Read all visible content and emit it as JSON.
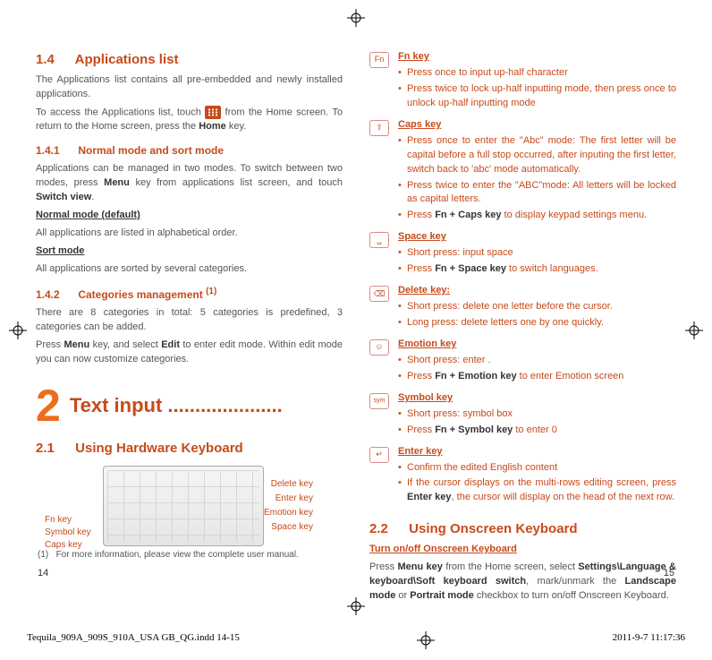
{
  "left": {
    "sec14_num": "1.4",
    "sec14_title": "Applications list",
    "sec14_p1": "The Applications list contains all pre-embedded and newly installed applications.",
    "sec14_p2a": "To access the Applications list, touch ",
    "sec14_p2b": " from the Home screen. To return to the Home screen, press the ",
    "sec14_p2c": " key.",
    "home": "Home",
    "sec141_num": "1.4.1",
    "sec141_title": "Normal mode and sort mode",
    "sec141_p1a": "Applications can be managed in two modes. To switch between two modes, press ",
    "menu": "Menu",
    "sec141_p1b": " key from applications list screen, and touch ",
    "switchview": "Switch view",
    "sec141_p1c": ".",
    "normal_mode": "Normal mode (default)",
    "normal_desc": "All applications are listed in alphabetical order.",
    "sort_mode": "Sort mode",
    "sort_desc": "All applications are sorted by several categories.",
    "sec142_num": "1.4.2",
    "sec142_title": "Categories management ",
    "sec142_sup": "(1)",
    "sec142_p1": "There are 8 categories in total: 5 categories is predefined, 3 categories can be added.",
    "sec142_p2a": "Press ",
    "sec142_p2b": " key, and select ",
    "edit": "Edit",
    "sec142_p2c": " to enter edit mode. Within edit mode you can now customize categories.",
    "chap2_num": "2",
    "chap2_title": "Text input .....................",
    "sec21_num": "2.1",
    "sec21_title": "Using Hardware Keyboard",
    "kbd_labels": {
      "delete": "Delete key",
      "enter": "Enter key",
      "emotion": "Emotion key",
      "space": "Space key",
      "fn": "Fn key",
      "symbol": "Symbol key",
      "caps": "Caps key"
    },
    "footnote_mark": "(1)",
    "footnote": "For more information, please view the complete user manual.",
    "pagenum": "14"
  },
  "right": {
    "fn": {
      "title": "Fn key",
      "items": [
        "Press once to input up-half character",
        "Press twice to lock up-half inputting mode, then press once to unlock up-half inputting mode"
      ]
    },
    "caps": {
      "title": "Caps key",
      "items": [
        "Press once to enter the \"Abc\" mode: The first letter will be capital before a full stop occurred, after inputing the first letter, switch back to 'abc' mode automatically.",
        "Press twice to enter the \"ABC\"mode: All letters will be locked as capital letters."
      ],
      "extra_pre": "Press ",
      "extra_bold": "Fn + Caps key",
      "extra_post": " to display keypad settings menu."
    },
    "space": {
      "title": "Space key",
      "i1": "Short press: input space",
      "i2_pre": "Press ",
      "i2_bold": "Fn + Space key",
      "i2_post": " to switch languages."
    },
    "delete": {
      "title": "Delete key:",
      "items": [
        "Short press: delete one letter before the cursor.",
        "Long press: delete letters one by one quickly."
      ]
    },
    "emotion": {
      "title": "Emotion key",
      "i1": "Short press:  enter .",
      "i2_pre": "Press ",
      "i2_bold": "Fn + Emotion key",
      "i2_post": " to enter Emotion screen"
    },
    "symbol": {
      "title": "Symbol key",
      "i1": "Short press: symbol box",
      "i2_pre": "Press ",
      "i2_bold": "Fn + Symbol key",
      "i2_post": " to enter 0"
    },
    "enter": {
      "title": "Enter key",
      "i1": "Confirm the edited English content",
      "i2_pre": "If the cursor displays on the multi-rows editing screen, press ",
      "i2_bold": "Enter key",
      "i2_post": ", the cursor will display on the head of the next row."
    },
    "sec22_num": "2.2",
    "sec22_title": "Using Onscreen Keyboard",
    "turn_title": "Turn on/off Onscreen Keyboard",
    "turn_p_a": "Press ",
    "menukey": "Menu key",
    "turn_p_b": " from the Home screen, select ",
    "settings_path": "Settings\\Language & keyboard\\Soft keyboard switch",
    "turn_p_c": ", mark/unmark the ",
    "landscape": "Landscape mode",
    "or": " or ",
    "portrait": "Portrait mode",
    "turn_p_d": " checkbox to turn on/off Onscreen Keyboard.",
    "pagenum": "15"
  },
  "printinfo": {
    "file": "Tequila_909A_909S_910A_USA GB_QG.indd   14-15",
    "date": "2011-9-7   11:17:36"
  }
}
